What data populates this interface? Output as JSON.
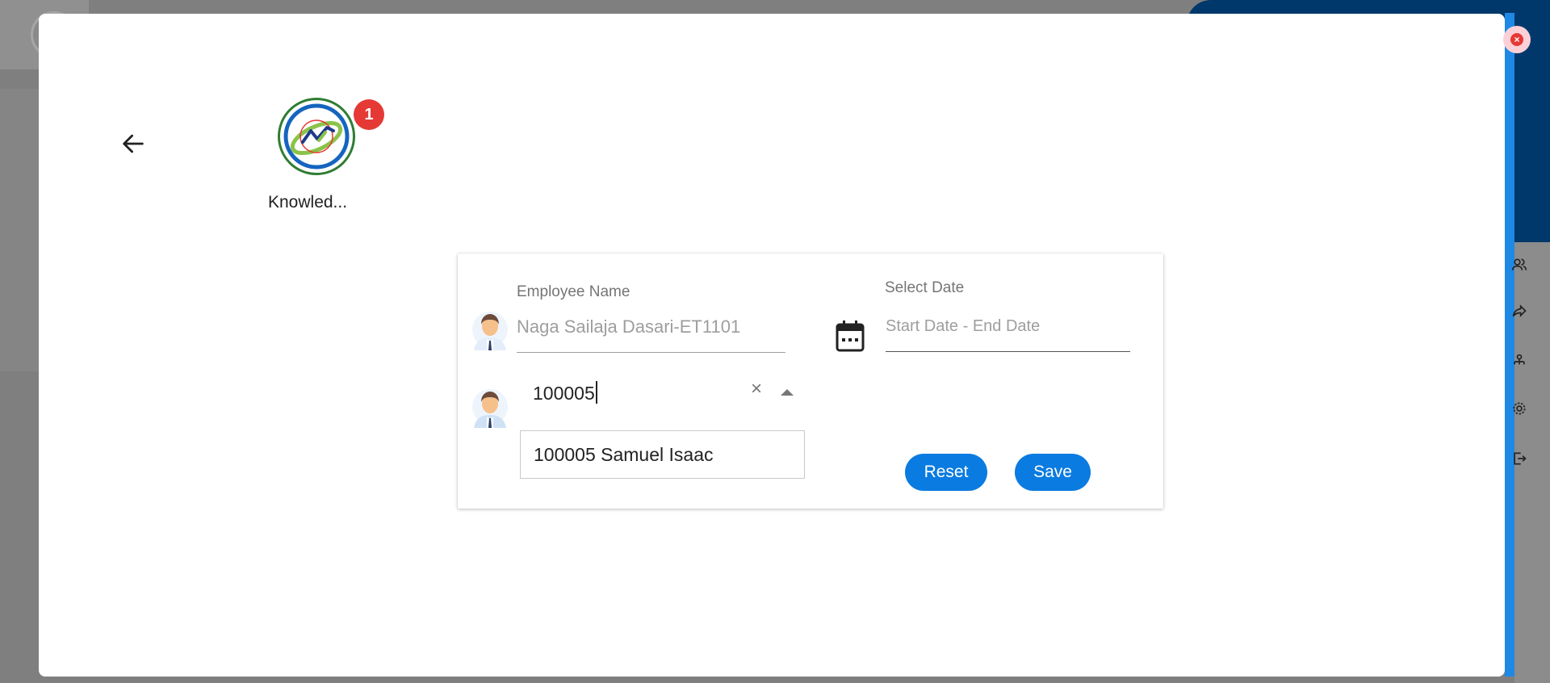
{
  "app_tile": {
    "label": "Knowled...",
    "badge_count": "1",
    "icon": "knowledge-logo"
  },
  "form": {
    "employee_name": {
      "label": "Employee Name",
      "placeholder": "Naga Sailaja Dasari-ET1101"
    },
    "date_range": {
      "label": "Select Date",
      "placeholder": "Start Date - End Date"
    },
    "employee_search": {
      "value": "100005"
    },
    "dropdown_options": [
      {
        "label": "100005 Samuel Isaac"
      }
    ],
    "reset_label": "Reset",
    "save_label": "Save"
  },
  "icons": {
    "back": "arrow-left-icon",
    "close": "close-circle-icon",
    "calendar": "calendar-icon",
    "clear": "clear-icon",
    "dropdown": "caret-up-icon",
    "avatar": "employee-avatar-icon"
  },
  "colors": {
    "primary_button": "#0a7be0",
    "badge": "#e53935",
    "close": "#e53935",
    "navy_header": "#00386b"
  }
}
